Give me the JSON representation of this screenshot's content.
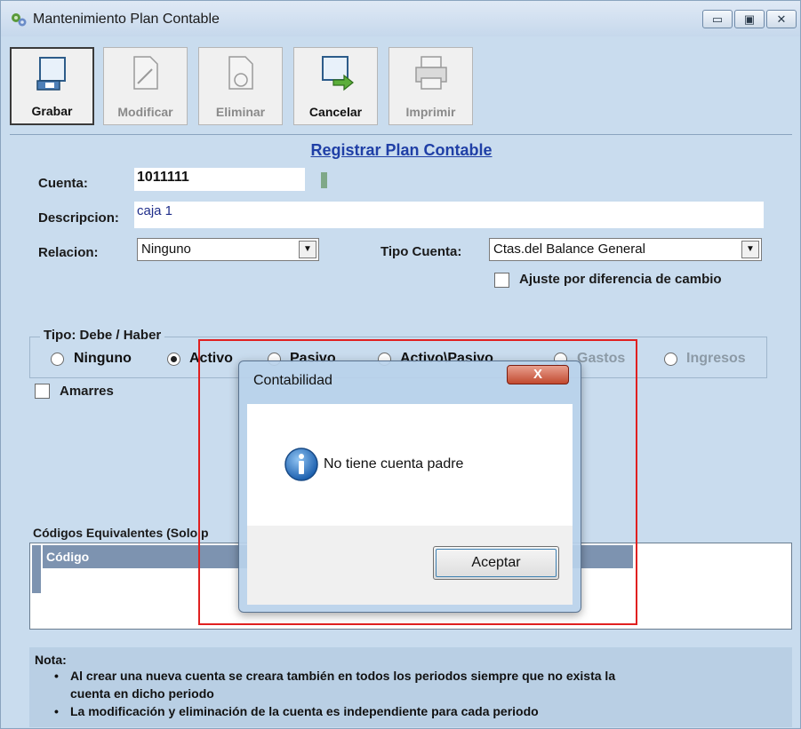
{
  "window": {
    "title": "Mantenimiento Plan Contable",
    "minimize_glyph": "▭",
    "maximize_glyph": "▣",
    "close_glyph": "✕",
    "app_icon": "gears-icon"
  },
  "toolbar": {
    "grabar_label": "Grabar",
    "modificar_label": "Modificar",
    "eliminar_label": "Eliminar",
    "cancelar_label": "Cancelar",
    "imprimir_label": "Imprimir"
  },
  "form": {
    "title": "Registrar Plan Contable",
    "cuenta_label": "Cuenta:",
    "cuenta_value": "1011111",
    "descripcion_label": "Descripcion:",
    "descripcion_value": "caja 1",
    "relacion_label": "Relacion:",
    "relacion_value": "Ninguno",
    "tipo_cuenta_label": "Tipo Cuenta:",
    "tipo_cuenta_value": "Ctas.del Balance General",
    "ajuste_label": "Ajuste por diferencia de cambio",
    "group_title": "Tipo: Debe / Haber",
    "radios": {
      "ninguno": "Ninguno",
      "activo": "Activo",
      "pasivo": "Pasivo",
      "activo_pasivo": "Activo\\Pasivo",
      "gastos": "Gastos",
      "ingresos": "Ingresos"
    },
    "amarres_label": "Amarres",
    "equivalentes_label": "Códigos Equivalentes (Solo p",
    "grid_header": "Código"
  },
  "note": {
    "title": "Nota:",
    "line1": "Al crear una nueva cuenta se creara también en todos los periodos siempre que no exista la",
    "line1b": "cuenta en dicho periodo",
    "line2": "La modificación y eliminación  de la cuenta es independiente para cada periodo"
  },
  "dialog": {
    "title": "Contabilidad",
    "message": "No tiene cuenta padre",
    "button": "Aceptar",
    "close_glyph": "X",
    "icon": "info-icon"
  },
  "colors": {
    "accent_title": "#1f3fa6",
    "highlight_border": "#e02020",
    "window_bg": "#c9dcee"
  }
}
